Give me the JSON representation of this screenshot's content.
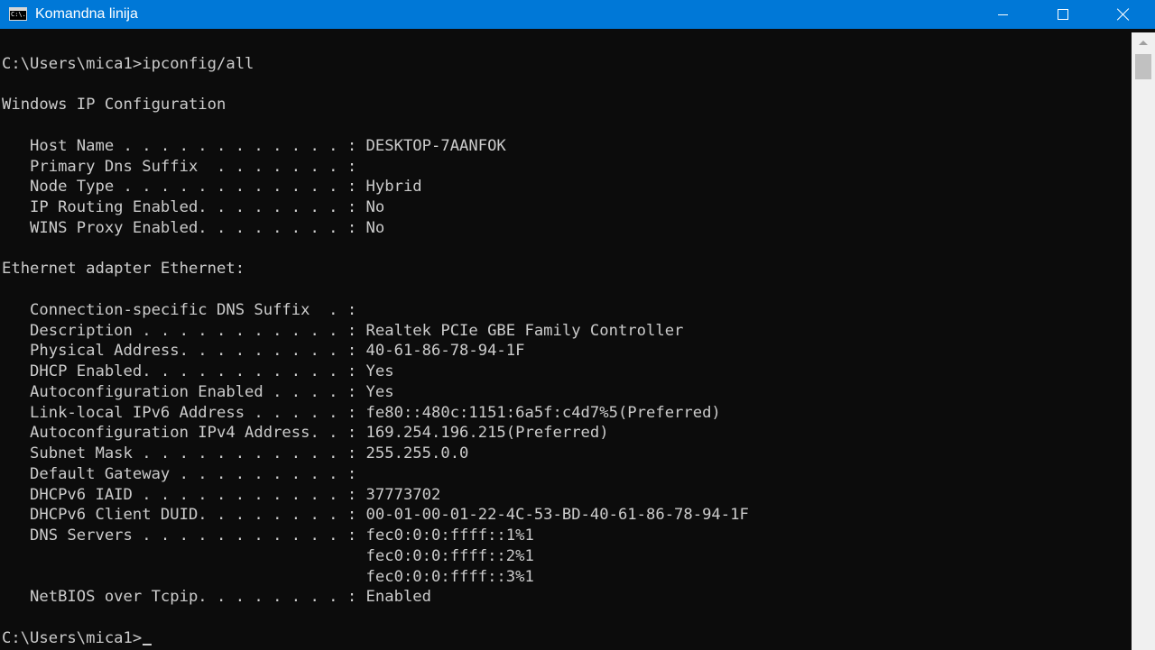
{
  "window": {
    "title": "Komandna linija",
    "icon": "cmd-icon",
    "icon_text": "C:\\.",
    "controls": {
      "minimize": "minimize-icon",
      "maximize": "maximize-icon",
      "close": "close-icon"
    },
    "titlebar_color": "#0078d7"
  },
  "console": {
    "background": "#0c0c0c",
    "foreground": "#cccccc",
    "lines": [
      "",
      "C:\\Users\\mica1>ipconfig/all",
      "",
      "Windows IP Configuration",
      "",
      "   Host Name . . . . . . . . . . . . : DESKTOP-7AANFOK",
      "   Primary Dns Suffix  . . . . . . . :",
      "   Node Type . . . . . . . . . . . . : Hybrid",
      "   IP Routing Enabled. . . . . . . . : No",
      "   WINS Proxy Enabled. . . . . . . . : No",
      "",
      "Ethernet adapter Ethernet:",
      "",
      "   Connection-specific DNS Suffix  . :",
      "   Description . . . . . . . . . . . : Realtek PCIe GBE Family Controller",
      "   Physical Address. . . . . . . . . : 40-61-86-78-94-1F",
      "   DHCP Enabled. . . . . . . . . . . : Yes",
      "   Autoconfiguration Enabled . . . . : Yes",
      "   Link-local IPv6 Address . . . . . : fe80::480c:1151:6a5f:c4d7%5(Preferred)",
      "   Autoconfiguration IPv4 Address. . : 169.254.196.215(Preferred)",
      "   Subnet Mask . . . . . . . . . . . : 255.255.0.0",
      "   Default Gateway . . . . . . . . . :",
      "   DHCPv6 IAID . . . . . . . . . . . : 37773702",
      "   DHCPv6 Client DUID. . . . . . . . : 00-01-00-01-22-4C-53-BD-40-61-86-78-94-1F",
      "   DNS Servers . . . . . . . . . . . : fec0:0:0:ffff::1%1",
      "                                       fec0:0:0:ffff::2%1",
      "                                       fec0:0:0:ffff::3%1",
      "   NetBIOS over Tcpip. . . . . . . . : Enabled",
      "",
      "C:\\Users\\mica1>"
    ]
  },
  "scrollbar": {
    "up_arrow": "scroll-up-arrow-icon"
  }
}
